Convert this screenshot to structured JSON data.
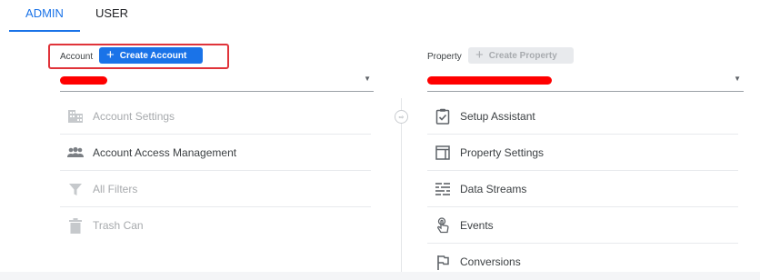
{
  "tabs": {
    "admin": "ADMIN",
    "user": "USER"
  },
  "account": {
    "label": "Account",
    "create_button": "Create Account",
    "items": [
      {
        "label": "Account Settings",
        "icon": "building-icon",
        "enabled": false
      },
      {
        "label": "Account Access Management",
        "icon": "people-icon",
        "enabled": true
      },
      {
        "label": "All Filters",
        "icon": "filter-icon",
        "enabled": false
      },
      {
        "label": "Trash Can",
        "icon": "trash-icon",
        "enabled": false
      }
    ]
  },
  "property": {
    "label": "Property",
    "create_button": "Create Property",
    "items": [
      {
        "label": "Setup Assistant",
        "icon": "clipboard-check-icon",
        "enabled": true
      },
      {
        "label": "Property Settings",
        "icon": "layout-icon",
        "enabled": true
      },
      {
        "label": "Data Streams",
        "icon": "streams-icon",
        "enabled": true
      },
      {
        "label": "Events",
        "icon": "touch-icon",
        "enabled": true
      },
      {
        "label": "Conversions",
        "icon": "flag-icon",
        "enabled": true
      }
    ]
  },
  "colors": {
    "accent": "#1a73e8",
    "highlight": "#e0333a",
    "redaction": "#ff0000"
  }
}
